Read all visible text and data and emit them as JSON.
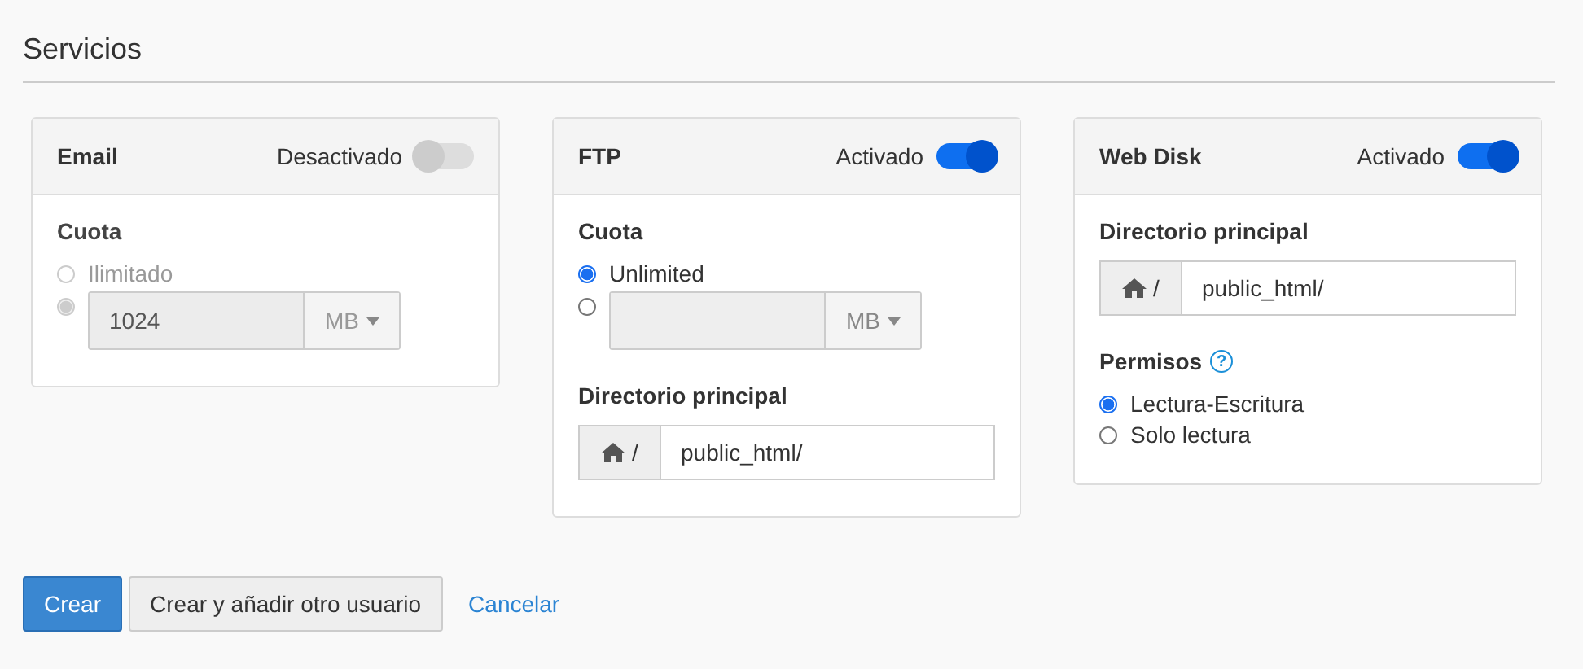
{
  "section_title": "Servicios",
  "cards": [
    {
      "title": "Email",
      "status": "Desactivado",
      "on": false,
      "disabled": true,
      "sections": [
        {
          "kind": "quota",
          "label": "Cuota",
          "unlimited": {
            "label": "Ilimitado",
            "selected": false
          },
          "custom": {
            "selected": true,
            "value": "1024",
            "unit": "MB"
          }
        }
      ]
    },
    {
      "title": "FTP",
      "status": "Activado",
      "on": true,
      "disabled": false,
      "sections": [
        {
          "kind": "quota",
          "label": "Cuota",
          "unlimited": {
            "label": "Unlimited",
            "selected": true
          },
          "custom": {
            "selected": false,
            "unit": "MB"
          }
        },
        {
          "kind": "directory",
          "label": "Directorio principal",
          "prefix": "/",
          "value": "public_html/"
        }
      ]
    },
    {
      "title": "Web Disk",
      "status": "Activado",
      "on": true,
      "disabled": false,
      "sections": [
        {
          "kind": "directory",
          "label": "Directorio principal",
          "prefix": "/",
          "value": "public_html/"
        },
        {
          "kind": "permissions",
          "label": "Permisos",
          "help": "?",
          "options": [
            {
              "label": "Lectura-Escritura",
              "selected": true
            },
            {
              "label": "Solo lectura",
              "selected": false
            }
          ]
        }
      ]
    }
  ],
  "buttons": [
    {
      "label": "Crear",
      "kind": "primary"
    },
    {
      "label": "Crear y añadir otro usuario",
      "kind": "default"
    },
    {
      "label": "Cancelar",
      "kind": "link"
    }
  ]
}
